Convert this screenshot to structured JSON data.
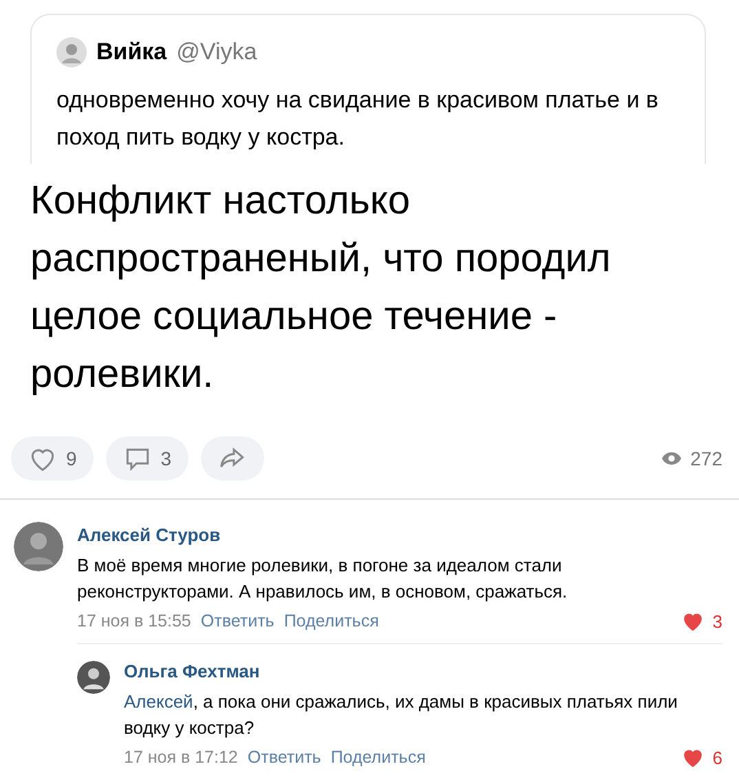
{
  "tweet": {
    "author": "Вийка",
    "handle": "@Viyka",
    "text": "одновременно хочу на свидание в красивом платье и в поход пить водку у костра."
  },
  "post_text": "Конфликт настолько распространеный, что породил целое социальное течение - ролевики.",
  "actions": [
    {
      "kind": "like",
      "count": "9"
    },
    {
      "kind": "comment",
      "count": "3"
    },
    {
      "kind": "share"
    }
  ],
  "views": "272",
  "comments": [
    {
      "author": "Алексей Стуров",
      "text": "В моё время многие ролевики, в погоне за идеалом стали реконструкторами. А нравилось им, в основом, сражаться.",
      "time": "17 ноя в 15:55",
      "reply": "Ответить",
      "share": "Поделиться",
      "liked": true,
      "likes": "3",
      "replies": [
        {
          "author": "Ольга Фехтман",
          "mention": "Алексей",
          "text": ", а пока они сражались, их дамы в красивых платьях пили водку у костра?",
          "time": "17 ноя в 17:12",
          "reply": "Ответить",
          "share": "Поделиться",
          "liked": true,
          "likes": "6"
        }
      ]
    }
  ]
}
